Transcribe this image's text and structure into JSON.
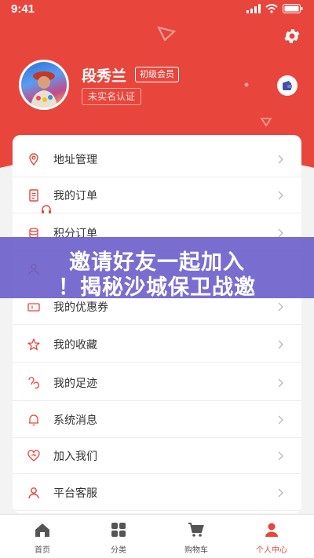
{
  "status_bar": {
    "time": "9:41"
  },
  "profile": {
    "name": "段秀兰",
    "level": "初级会员",
    "verify_status": "未实名认证"
  },
  "menu": [
    {
      "label": "地址管理",
      "icon": "location-icon"
    },
    {
      "label": "我的订单",
      "icon": "order-icon"
    },
    {
      "label": "积分订单",
      "icon": "points-icon"
    },
    {
      "label": "",
      "icon": "user-icon"
    },
    {
      "label": "我的优惠券",
      "icon": "coupon-icon"
    },
    {
      "label": "我的收藏",
      "icon": "star-icon"
    },
    {
      "label": "我的足迹",
      "icon": "footprint-icon"
    },
    {
      "label": "系统消息",
      "icon": "bell-icon"
    },
    {
      "label": "加入我们",
      "icon": "heart-icon"
    },
    {
      "label": "平台客服",
      "icon": "person-icon"
    }
  ],
  "overlay": {
    "line1": "邀请好友一起加入",
    "line2": "！揭秘沙城保卫战邀"
  },
  "tabbar": [
    {
      "label": "首页",
      "icon": "home-icon"
    },
    {
      "label": "分类",
      "icon": "category-icon"
    },
    {
      "label": "购物车",
      "icon": "cart-icon"
    },
    {
      "label": "个人中心",
      "icon": "profile-icon"
    }
  ],
  "colors": {
    "accent": "#e8463c",
    "overlay": "#665ac8"
  }
}
